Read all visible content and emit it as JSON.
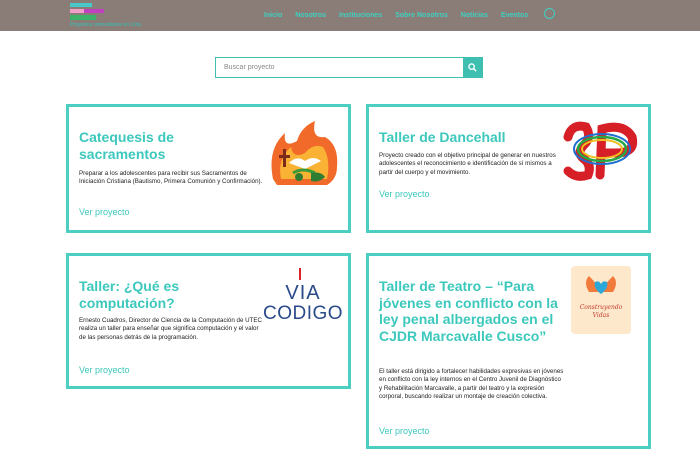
{
  "header": {
    "logo_tagline": "Proyectos comunitarios en Lima",
    "nav": [
      "Inicio",
      "Nosotros",
      "Instituciones",
      "Sobre Nosotros",
      "Noticias",
      "Eventos"
    ]
  },
  "search": {
    "placeholder": "Buscar proyecto"
  },
  "colors": {
    "accent": "#4ccfc0",
    "topbar": "#8a7d78"
  },
  "cards": [
    {
      "title": "Catequesis de sacramentos",
      "description": "Preparar a los adolescentes para recibir sus Sacramentos de Iniciación Cristiana (Bautismo, Primera Comunión y Confirmación).",
      "link": "Ver proyecto",
      "image": "flame-dove-logo"
    },
    {
      "title": "Taller de Dancehall",
      "description": "Proyecto creado con el objetivo principal de generar en nuestros adolescentes el reconocimiento e identificación de sí mismos a partir del cuerpo y el movimiento.",
      "link": "Ver proyecto",
      "image": "dancehall-logo"
    },
    {
      "title": "Taller: ¿Qué es computación?",
      "description": "Ernesto Cuadros, Director de Ciencia de la Computación de UTEC realiza un taller para enseñar que significa computación y el valor de las personas detrás de la programación.",
      "link": "Ver proyecto",
      "image": "via-codigo-logo",
      "logo_top": "VIA",
      "logo_bottom": "CODIGO"
    },
    {
      "title": "Taller de Teatro – “Para jóvenes en conflicto con la ley penal albergados en el CJDR Marcavalle Cusco”",
      "description": "El taller está dirigido a fortalecer habilidades expresivas en jóvenes en conflicto con la ley internos en el Centro Juvenil de Diagnóstico y Rehabilitación Marcavalle, a partir del teatro y la expresión corporal, buscando realizar un montaje de creación colectiva.",
      "link": "Ver proyecto",
      "image": "construyendo-vidas-logo",
      "logo_text": "Construyendo Vidas"
    }
  ]
}
